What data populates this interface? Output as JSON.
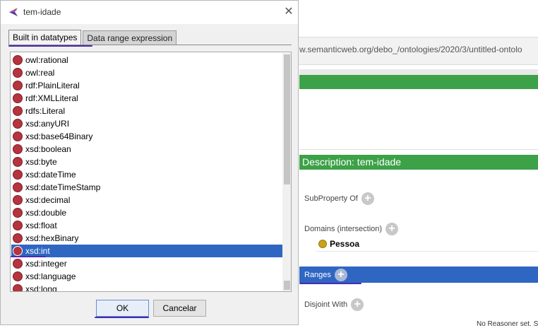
{
  "background": {
    "url": "w.semanticweb.org/debo_/ontologies/2020/3/untitled-ontolo",
    "description_header": "Description: tem-idade",
    "sections": {
      "subproperty_of": "SubProperty Of",
      "domains": "Domains (intersection)",
      "ranges": "Ranges",
      "disjoint_with": "Disjoint With"
    },
    "plus_glyph": "+",
    "domain_item": "Pessoa",
    "status_text": "No Reasoner set. S"
  },
  "dialog": {
    "title": "tem-idade",
    "close_glyph": "✕",
    "tabs": [
      {
        "label": "Built in datatypes",
        "active": true
      },
      {
        "label": "Data range expression",
        "active": false
      }
    ],
    "datatypes": [
      "owl:rational",
      "owl:real",
      "rdf:PlainLiteral",
      "rdf:XMLLiteral",
      "rdfs:Literal",
      "xsd:anyURI",
      "xsd:base64Binary",
      "xsd:boolean",
      "xsd:byte",
      "xsd:dateTime",
      "xsd:dateTimeStamp",
      "xsd:decimal",
      "xsd:double",
      "xsd:float",
      "xsd:hexBinary",
      "xsd:int",
      "xsd:integer",
      "xsd:language",
      "xsd:long"
    ],
    "selected_datatype": "xsd:int",
    "ok_label": "OK",
    "cancel_label": "Cancelar"
  },
  "colors": {
    "accent_green": "#3ca147",
    "selection_blue": "#2f66c2",
    "datatype_bullet": "#b5343f",
    "annotation_underline": "#4a2bb0"
  }
}
